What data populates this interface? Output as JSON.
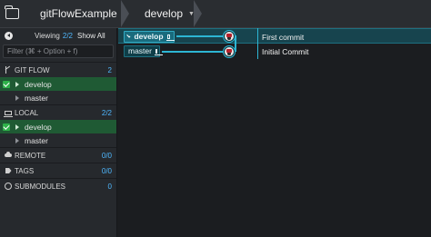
{
  "toolbar": {
    "repo": "gitFlowExample",
    "branch": "develop"
  },
  "sidebar": {
    "viewing_label": "Viewing",
    "viewing_count": "2/2",
    "show_all": "Show All",
    "filter_placeholder": "Filter (⌘ + Option + f)",
    "gitflow": {
      "label": "GIT FLOW",
      "count": "2",
      "items": [
        "develop",
        "master"
      ]
    },
    "local": {
      "label": "LOCAL",
      "count": "2/2",
      "items": [
        "develop",
        "master"
      ]
    },
    "remote": {
      "label": "REMOTE",
      "count": "0/0"
    },
    "tags": {
      "label": "TAGS",
      "count": "0/0"
    },
    "submodules": {
      "label": "SUBMODULES",
      "count": "0"
    }
  },
  "graph": {
    "commits": [
      {
        "branch_label": "develop",
        "message": "First commit",
        "checked_out": true
      },
      {
        "branch_label": "master",
        "message": "Initial Commit",
        "checked_out": false
      }
    ]
  },
  "colors": {
    "accent": "#2db6d4",
    "active_branch_bg": "#1f5a34",
    "count_blue": "#4fb8ff"
  }
}
